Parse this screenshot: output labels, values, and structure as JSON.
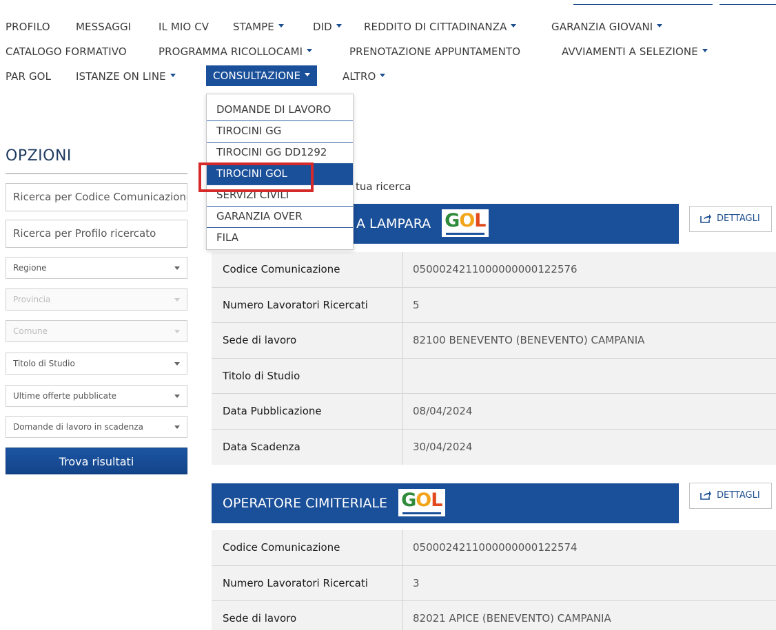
{
  "nav": {
    "row1": [
      {
        "label": "PROFILO",
        "dropdown": false
      },
      {
        "label": "MESSAGGI",
        "dropdown": false
      },
      {
        "label": "IL MIO CV",
        "dropdown": false
      },
      {
        "label": "STAMPE",
        "dropdown": true
      },
      {
        "label": "DID",
        "dropdown": true
      },
      {
        "label": "REDDITO DI CITTADINANZA",
        "dropdown": true
      },
      {
        "label": "GARANZIA GIOVANI",
        "dropdown": true
      }
    ],
    "row2": [
      {
        "label": "CATALOGO FORMATIVO",
        "dropdown": false
      },
      {
        "label": "PROGRAMMA RICOLLOCAMI",
        "dropdown": true
      },
      {
        "label": "PRENOTAZIONE APPUNTAMENTO",
        "dropdown": false
      },
      {
        "label": "AVVIAMENTI A SELEZIONE",
        "dropdown": true
      }
    ],
    "row3": [
      {
        "label": "PAR GOL",
        "dropdown": false
      },
      {
        "label": "ISTANZE ON LINE",
        "dropdown": true
      },
      {
        "label": "CONSULTAZIONE",
        "dropdown": true,
        "active": true
      },
      {
        "label": "ALTRO",
        "dropdown": true
      }
    ]
  },
  "dropdown_menu": {
    "items": [
      "DOMANDE DI LAVORO",
      "TIROCINI GG",
      "TIROCINI GG DD1292",
      "TIROCINI GOL",
      "SERVIZI CIVILI",
      "GARANZIA OVER",
      "FILA"
    ],
    "highlighted": "TIROCINI GOL"
  },
  "sidebar": {
    "title": "OPZIONI",
    "search_code_placeholder": "Ricerca per Codice Comunicazione",
    "search_profile_placeholder": "Ricerca per Profilo ricercato",
    "selects": [
      {
        "label": "Regione",
        "disabled": false
      },
      {
        "label": "Provincia",
        "disabled": true
      },
      {
        "label": "Comune",
        "disabled": true
      },
      {
        "label": "Titolo di Studio",
        "disabled": false
      },
      {
        "label": "Ultime offerte pubblicate",
        "disabled": false
      },
      {
        "label": "Domande di lavoro in scadenza",
        "disabled": false
      }
    ],
    "search_button": "Trova risultati"
  },
  "results": {
    "crumb_text": "tua ricerca",
    "details_label": "DETTAGLI",
    "cards": [
      {
        "title": "A LAMPARA",
        "logo": "GOL",
        "rows": [
          {
            "label": "Codice Comunicazione",
            "value": "0500024211000000000122576"
          },
          {
            "label": "Numero Lavoratori Ricercati",
            "value": "5"
          },
          {
            "label": "Sede di lavoro",
            "value": "82100 BENEVENTO (BENEVENTO) CAMPANIA"
          },
          {
            "label": "Titolo di Studio",
            "value": ""
          },
          {
            "label": "Data Pubblicazione",
            "value": "08/04/2024"
          },
          {
            "label": "Data Scadenza",
            "value": "30/04/2024"
          }
        ]
      },
      {
        "title": "OPERATORE CIMITERIALE",
        "logo": "GOL",
        "rows": [
          {
            "label": "Codice Comunicazione",
            "value": "0500024211000000000122574"
          },
          {
            "label": "Numero Lavoratori Ricercati",
            "value": "3"
          },
          {
            "label": "Sede di lavoro",
            "value": "82021 APICE (BENEVENTO) CAMPANIA"
          }
        ]
      }
    ]
  },
  "colors": {
    "primary": "#1a4f99",
    "highlight_box": "#d62a2a",
    "table_bg": "#f2f2f2"
  }
}
